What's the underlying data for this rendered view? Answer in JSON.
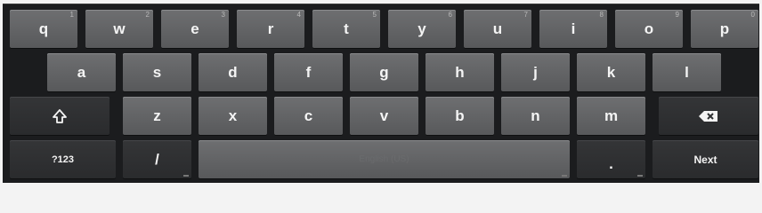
{
  "keyboard": {
    "row1": [
      {
        "label": "q",
        "hint": "1"
      },
      {
        "label": "w",
        "hint": "2"
      },
      {
        "label": "e",
        "hint": "3"
      },
      {
        "label": "r",
        "hint": "4"
      },
      {
        "label": "t",
        "hint": "5"
      },
      {
        "label": "y",
        "hint": "6"
      },
      {
        "label": "u",
        "hint": "7"
      },
      {
        "label": "i",
        "hint": "8"
      },
      {
        "label": "o",
        "hint": "9"
      },
      {
        "label": "p",
        "hint": "0"
      }
    ],
    "row2": [
      "a",
      "s",
      "d",
      "f",
      "g",
      "h",
      "j",
      "k",
      "l"
    ],
    "row3": [
      "z",
      "x",
      "c",
      "v",
      "b",
      "n",
      "m"
    ],
    "shift_icon": "shift-arrow-icon",
    "backspace_icon": "backspace-icon",
    "symbols_label": "?123",
    "slash_label": "/",
    "space_label": "English (US)",
    "period_label": ".",
    "enter_label": "Next",
    "colors": {
      "background": "#1b1c1e",
      "key": "#626365",
      "dark_key": "#2f3032",
      "text": "#f4f4f4"
    }
  }
}
